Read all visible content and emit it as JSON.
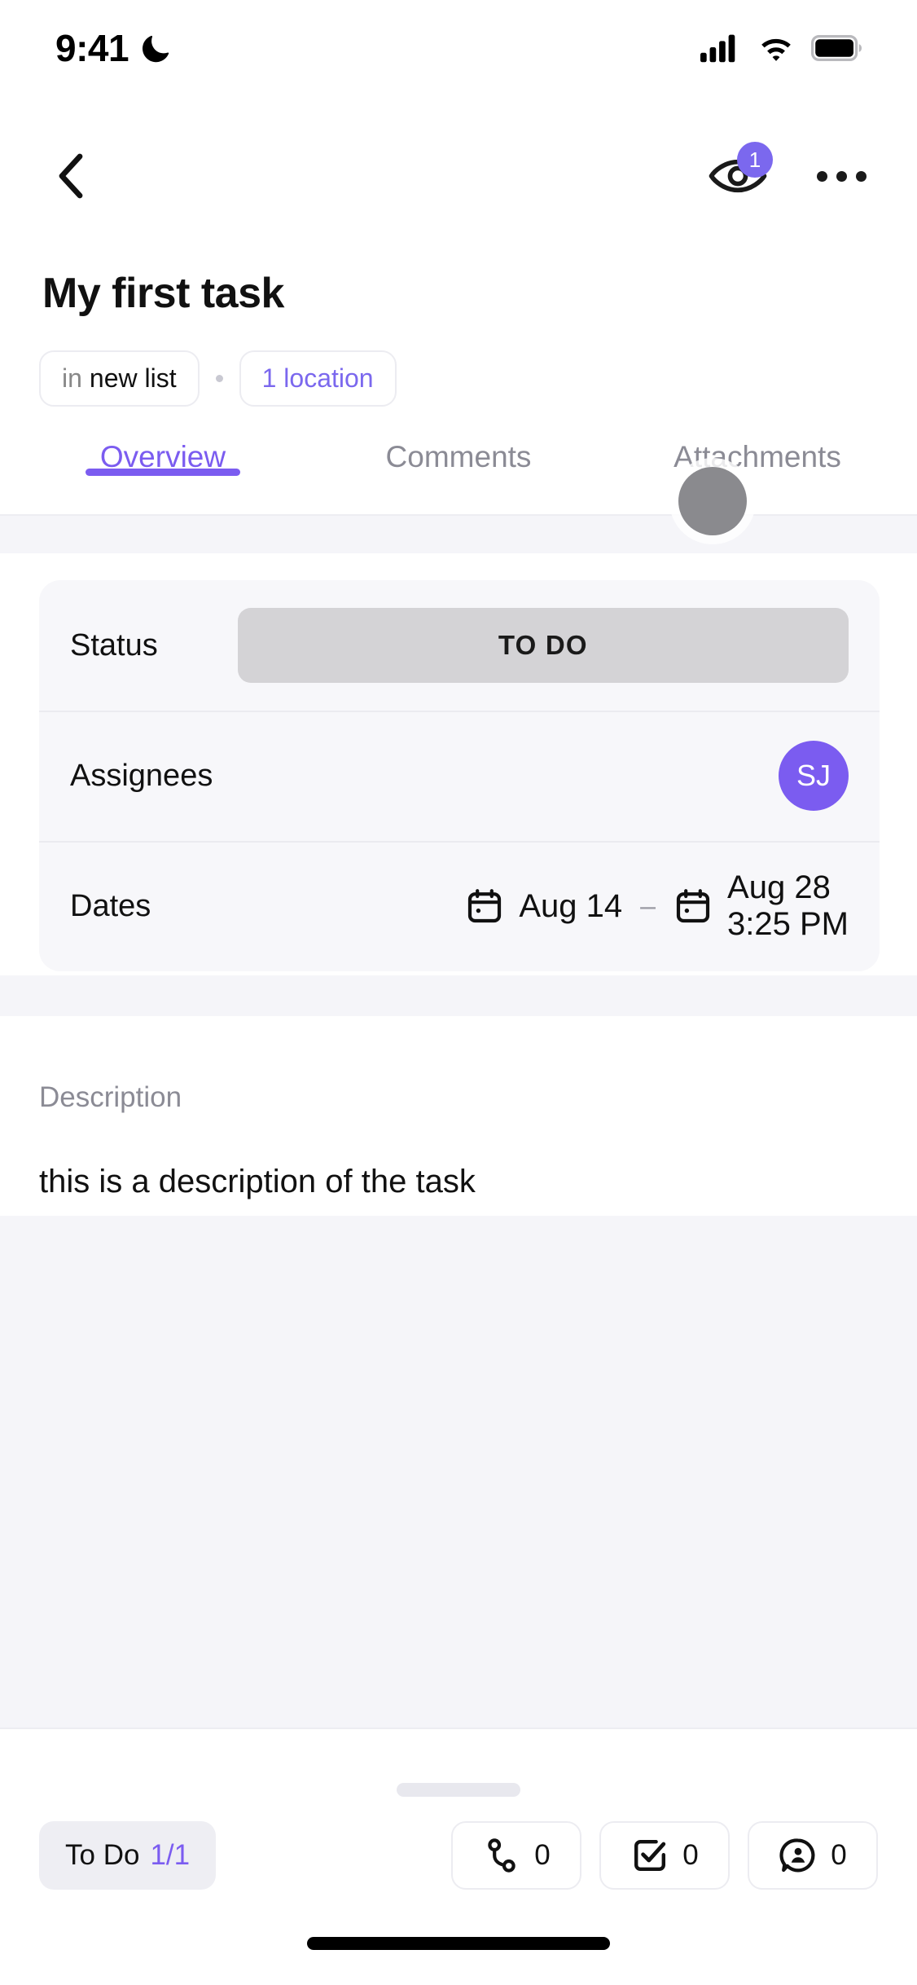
{
  "status_bar": {
    "time": "9:41",
    "dnd_icon": "moon-icon",
    "signal_icon": "cellular-signal-icon",
    "wifi_icon": "wifi-icon",
    "battery_icon": "battery-full-icon"
  },
  "nav": {
    "back_icon": "chevron-left-icon",
    "watchers_icon": "eye-icon",
    "watchers_badge": "1",
    "overflow_icon": "ellipsis-icon"
  },
  "header": {
    "title": "My first task",
    "list_chip_prefix": "in",
    "list_chip_name": "new list",
    "location_chip": "1 location"
  },
  "tabs": [
    {
      "label": "Overview",
      "active": true
    },
    {
      "label": "Comments",
      "active": false
    },
    {
      "label": "Attachments",
      "active": false
    }
  ],
  "details": {
    "status": {
      "label": "Status",
      "value": "TO DO"
    },
    "assignees": {
      "label": "Assignees",
      "avatar_initials": "SJ"
    },
    "dates": {
      "label": "Dates",
      "start_icon": "calendar-icon",
      "start": "Aug 14",
      "separator": "–",
      "end_icon": "calendar-icon",
      "end_date": "Aug 28",
      "end_time": "3:25 PM"
    }
  },
  "description": {
    "label": "Description",
    "body": "this is a description of the task"
  },
  "bottom_bar": {
    "todo_label": "To Do",
    "todo_count": "1/1",
    "actions": [
      {
        "icon": "relationship-icon",
        "count": "0"
      },
      {
        "icon": "checklist-icon",
        "count": "0"
      },
      {
        "icon": "comment-person-icon",
        "count": "0"
      }
    ]
  },
  "colors": {
    "accent_purple": "#7b5cf0",
    "badge_purple": "#7b68ee",
    "status_pill_gray": "#d4d3d6",
    "card_bg": "#f7f7fa",
    "section_bg": "#f5f5f9"
  }
}
